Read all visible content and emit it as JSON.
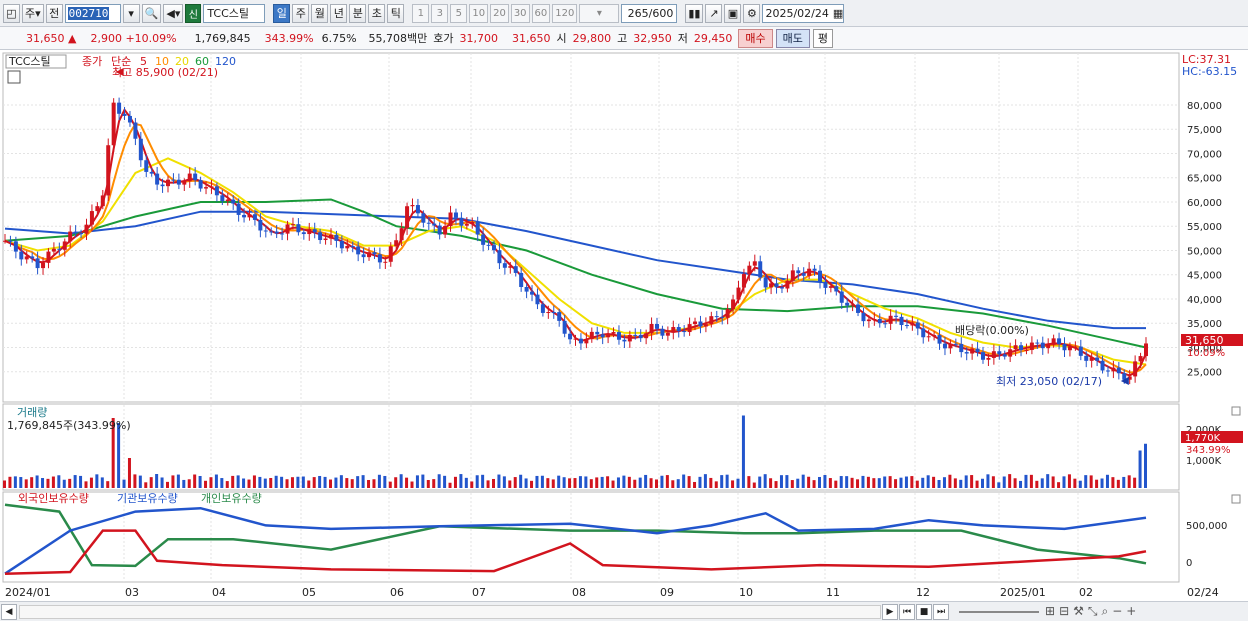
{
  "toolbar": {
    "mode_label": "주",
    "prev_label": "전",
    "code_value": "002710",
    "new_badge": "신",
    "stock_name": "TCC스틸",
    "periods": [
      "일",
      "주",
      "월",
      "년",
      "분",
      "초",
      "틱"
    ],
    "active_period": "일",
    "numbers": [
      "1",
      "3",
      "5",
      "10",
      "20",
      "30",
      "60",
      "120"
    ],
    "count_value": "265/600",
    "date_value": "2025/02/24"
  },
  "infobar": {
    "price": "31,650",
    "change_arrow": "▲",
    "change": "2,900",
    "change_pct": "+10.09%",
    "volume": "1,769,845",
    "volume_ratio": "343.99%",
    "turnover": "6.75%",
    "amount": "55,708백만",
    "quote_label": "호가",
    "ask": "31,700",
    "bid": "31,650",
    "open_label": "시",
    "open": "29,800",
    "high_label": "고",
    "high": "32,950",
    "low_label": "저",
    "low": "29,450",
    "buy_label": "매수",
    "sell_label": "매도",
    "eval_label": "평"
  },
  "chart_data": {
    "type": "candlestick",
    "title": "TCC스틸",
    "price_legend": {
      "close_label": "종가",
      "ma_label": "단순",
      "periods": [
        {
          "label": "5",
          "color": "#d2141e"
        },
        {
          "label": "10",
          "color": "#ff8c00"
        },
        {
          "label": "20",
          "color": "#e8d800"
        },
        {
          "label": "60",
          "color": "#1a9a3a"
        },
        {
          "label": "120",
          "color": "#2255cc"
        }
      ]
    },
    "y_ticks": [
      80000,
      75000,
      70000,
      65000,
      60000,
      55000,
      50000,
      45000,
      40000,
      35000,
      30000,
      25000
    ],
    "y_tick_labels": [
      "80,000",
      "75,000",
      "70,000",
      "65,000",
      "60,000",
      "55,000",
      "50,000",
      "45,000",
      "40,000",
      "35,000",
      "30,000",
      "25,000"
    ],
    "ylim": [
      20000,
      87000
    ],
    "lc": "LC:37.31",
    "hc": "HC:-63.15",
    "last_price": "31,650",
    "last_pct": "10.09%",
    "high_annotation": "최고 85,900 (02/21)",
    "low_annotation": "최저 23,050 (02/17)",
    "dividend_annotation": "배당락(0.00%)",
    "x_labels": [
      "2024/01",
      "03",
      "04",
      "05",
      "06",
      "07",
      "08",
      "09",
      "10",
      "11",
      "12",
      "2025/01",
      "02",
      "02/24"
    ],
    "x_label_positions": [
      0,
      0.15,
      0.245,
      0.355,
      0.452,
      0.555,
      0.66,
      0.76,
      0.85,
      0.95,
      1.06,
      1.17,
      1.26
    ],
    "close_series": [
      [
        0,
        52000
      ],
      [
        3,
        49000
      ],
      [
        6,
        47000
      ],
      [
        9,
        50000
      ],
      [
        12,
        53000
      ],
      [
        15,
        55000
      ],
      [
        18,
        62000
      ],
      [
        20,
        80000
      ],
      [
        22,
        78000
      ],
      [
        24,
        73000
      ],
      [
        26,
        66000
      ],
      [
        28,
        64000
      ],
      [
        31,
        64000
      ],
      [
        34,
        65000
      ],
      [
        37,
        63000
      ],
      [
        40,
        61000
      ],
      [
        43,
        58000
      ],
      [
        46,
        56000
      ],
      [
        49,
        53000
      ],
      [
        52,
        55000
      ],
      [
        55,
        54000
      ],
      [
        58,
        53000
      ],
      [
        61,
        52000
      ],
      [
        64,
        50000
      ],
      [
        67,
        49000
      ],
      [
        70,
        48000
      ],
      [
        72,
        52000
      ],
      [
        74,
        59000
      ],
      [
        76,
        58000
      ],
      [
        78,
        55000
      ],
      [
        80,
        54000
      ],
      [
        82,
        57000
      ],
      [
        84,
        56000
      ],
      [
        86,
        55000
      ],
      [
        88,
        52000
      ],
      [
        91,
        48000
      ],
      [
        94,
        45000
      ],
      [
        97,
        40000
      ],
      [
        100,
        37000
      ],
      [
        102,
        36000
      ],
      [
        104,
        31000
      ],
      [
        107,
        32000
      ],
      [
        110,
        33000
      ],
      [
        113,
        32000
      ],
      [
        116,
        32000
      ],
      [
        119,
        34000
      ],
      [
        122,
        33000
      ],
      [
        125,
        34000
      ],
      [
        128,
        35000
      ],
      [
        131,
        36000
      ],
      [
        134,
        39000
      ],
      [
        136,
        46000
      ],
      [
        138,
        47000
      ],
      [
        140,
        43000
      ],
      [
        142,
        42000
      ],
      [
        145,
        45000
      ],
      [
        148,
        46000
      ],
      [
        151,
        43000
      ],
      [
        154,
        40000
      ],
      [
        157,
        37000
      ],
      [
        160,
        35000
      ],
      [
        163,
        36000
      ],
      [
        166,
        35000
      ],
      [
        169,
        33000
      ],
      [
        172,
        31000
      ],
      [
        175,
        30000
      ],
      [
        178,
        29000
      ],
      [
        181,
        28000
      ],
      [
        184,
        29000
      ],
      [
        187,
        30000
      ],
      [
        190,
        30500
      ],
      [
        193,
        31000
      ],
      [
        196,
        30000
      ],
      [
        199,
        28000
      ],
      [
        202,
        26000
      ],
      [
        205,
        24500
      ],
      [
        207,
        24000
      ],
      [
        209,
        28500
      ],
      [
        210,
        31650
      ]
    ],
    "ma20_series": [
      [
        0,
        52000
      ],
      [
        6,
        50000
      ],
      [
        12,
        51000
      ],
      [
        18,
        56000
      ],
      [
        24,
        66000
      ],
      [
        30,
        69000
      ],
      [
        36,
        66000
      ],
      [
        42,
        62000
      ],
      [
        48,
        57000
      ],
      [
        54,
        55000
      ],
      [
        60,
        54000
      ],
      [
        66,
        51000
      ],
      [
        72,
        51000
      ],
      [
        78,
        54000
      ],
      [
        84,
        55000
      ],
      [
        90,
        52000
      ],
      [
        96,
        46000
      ],
      [
        102,
        40000
      ],
      [
        108,
        35000
      ],
      [
        114,
        33000
      ],
      [
        120,
        33000
      ],
      [
        126,
        34000
      ],
      [
        132,
        36000
      ],
      [
        138,
        41000
      ],
      [
        144,
        44000
      ],
      [
        150,
        44000
      ],
      [
        156,
        41000
      ],
      [
        162,
        38000
      ],
      [
        168,
        36000
      ],
      [
        174,
        33000
      ],
      [
        180,
        31000
      ],
      [
        186,
        30000
      ],
      [
        192,
        30500
      ],
      [
        198,
        30000
      ],
      [
        204,
        27500
      ],
      [
        210,
        26500
      ]
    ],
    "ma60_series": [
      [
        0,
        52000
      ],
      [
        12,
        53000
      ],
      [
        24,
        57000
      ],
      [
        36,
        60000
      ],
      [
        48,
        60000
      ],
      [
        60,
        60500
      ],
      [
        66,
        58000
      ],
      [
        72,
        55000
      ],
      [
        84,
        53000
      ],
      [
        96,
        50000
      ],
      [
        108,
        45000
      ],
      [
        120,
        41000
      ],
      [
        132,
        38000
      ],
      [
        144,
        37500
      ],
      [
        156,
        38500
      ],
      [
        168,
        38500
      ],
      [
        180,
        37000
      ],
      [
        192,
        34500
      ],
      [
        204,
        31500
      ],
      [
        210,
        30000
      ]
    ],
    "ma120_series": [
      [
        0,
        54500
      ],
      [
        12,
        53500
      ],
      [
        24,
        55000
      ],
      [
        36,
        58000
      ],
      [
        48,
        58000
      ],
      [
        60,
        57500
      ],
      [
        72,
        57000
      ],
      [
        84,
        56500
      ],
      [
        96,
        54000
      ],
      [
        108,
        51000
      ],
      [
        120,
        48000
      ],
      [
        132,
        46000
      ],
      [
        144,
        44000
      ],
      [
        156,
        43000
      ],
      [
        168,
        41000
      ],
      [
        180,
        38000
      ],
      [
        192,
        35500
      ],
      [
        204,
        34000
      ],
      [
        210,
        34000
      ]
    ],
    "volume": {
      "title": "거래량",
      "last_label": "1,769,845주(343.99%)",
      "y_tick_labels": [
        "2,000K",
        "1,000K"
      ],
      "last_value_label": "1,770K",
      "last_ratio_label": "343.99%",
      "ylim": [
        0,
        3000000
      ],
      "spikes": [
        [
          20,
          2800000
        ],
        [
          21,
          2600000
        ],
        [
          23,
          1200000
        ],
        [
          136,
          2900000
        ],
        [
          209,
          1500000
        ],
        [
          210,
          1769845
        ]
      ]
    },
    "holdings": {
      "legend": [
        {
          "label": "외국인보유수량",
          "color": "#d2141e"
        },
        {
          "label": "기관보유수량",
          "color": "#2255cc"
        },
        {
          "label": "개인보유수량",
          "color": "#2a8a4a"
        }
      ],
      "y_tick_labels": [
        "500,000",
        "0"
      ],
      "foreign_series": [
        [
          0,
          0
        ],
        [
          12,
          20000
        ],
        [
          18,
          500000
        ],
        [
          24,
          500000
        ],
        [
          28,
          150000
        ],
        [
          40,
          100000
        ],
        [
          60,
          50000
        ],
        [
          90,
          30000
        ],
        [
          104,
          350000
        ],
        [
          110,
          100000
        ],
        [
          130,
          50000
        ],
        [
          150,
          100000
        ],
        [
          170,
          80000
        ],
        [
          190,
          150000
        ],
        [
          205,
          200000
        ],
        [
          210,
          260000
        ]
      ],
      "institution_series": [
        [
          0,
          0
        ],
        [
          12,
          500000
        ],
        [
          24,
          720000
        ],
        [
          36,
          760000
        ],
        [
          48,
          560000
        ],
        [
          60,
          520000
        ],
        [
          80,
          550000
        ],
        [
          104,
          580000
        ],
        [
          120,
          470000
        ],
        [
          130,
          560000
        ],
        [
          140,
          700000
        ],
        [
          146,
          500000
        ],
        [
          160,
          520000
        ],
        [
          170,
          620000
        ],
        [
          180,
          560000
        ],
        [
          195,
          520000
        ],
        [
          210,
          650000
        ]
      ],
      "individual_series": [
        [
          0,
          800000
        ],
        [
          10,
          720000
        ],
        [
          16,
          100000
        ],
        [
          24,
          90000
        ],
        [
          30,
          400000
        ],
        [
          42,
          400000
        ],
        [
          60,
          280000
        ],
        [
          80,
          550000
        ],
        [
          104,
          500000
        ],
        [
          120,
          500000
        ],
        [
          136,
          470000
        ],
        [
          146,
          470000
        ],
        [
          160,
          500000
        ],
        [
          176,
          500000
        ],
        [
          190,
          280000
        ],
        [
          205,
          180000
        ],
        [
          210,
          120000
        ]
      ]
    }
  },
  "bottom": {
    "icons": [
      "◀",
      "▶",
      "⏮",
      "■",
      "⏭"
    ]
  }
}
